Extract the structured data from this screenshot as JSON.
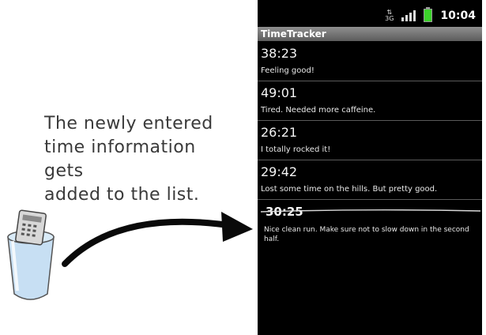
{
  "annotation": {
    "lines": [
      "The newly entered",
      "time information gets",
      "added to the list."
    ]
  },
  "status_bar": {
    "network": "3G",
    "time": "10:04"
  },
  "app": {
    "title": "TimeTracker"
  },
  "entries": [
    {
      "time": "38:23",
      "note": "Feeling good!"
    },
    {
      "time": "49:01",
      "note": "Tired. Needed more caffeine."
    },
    {
      "time": "26:21",
      "note": "I totally rocked it!"
    },
    {
      "time": "29:42",
      "note": "Lost some time on the hills. But pretty good."
    },
    {
      "time": "30:25",
      "note": "Nice clean run. Make sure not to slow down in the second half."
    }
  ],
  "icons": {
    "signal": "signal-icon",
    "battery": "battery-icon",
    "network": "network-3g-icon",
    "arrow": "arrow-icon",
    "cup": "cup-icon"
  },
  "colors": {
    "screen": "#000000",
    "titlebar": "#6e6e6e",
    "battery": "#3bd12a",
    "arrow": "#0a0a0a"
  }
}
